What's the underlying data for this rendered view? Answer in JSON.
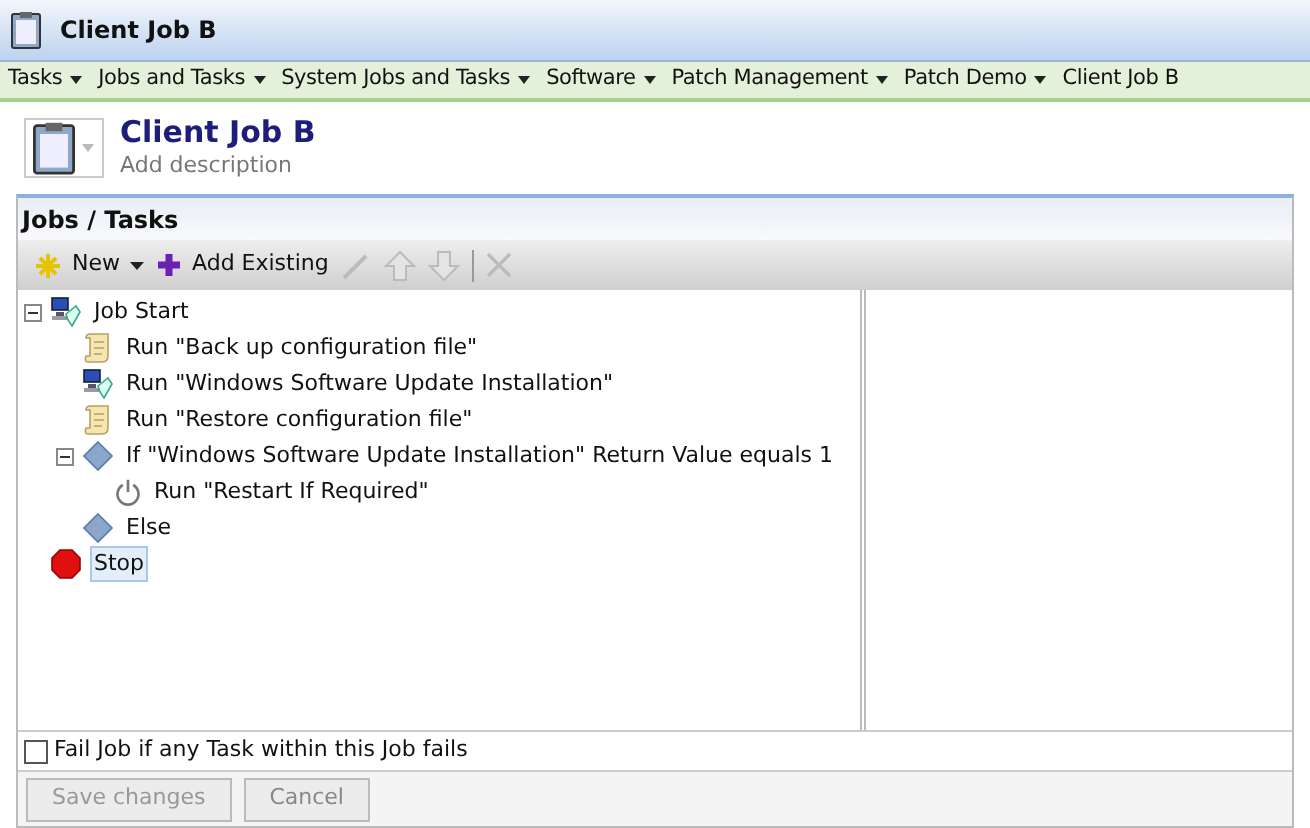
{
  "window": {
    "title": "Client Job B"
  },
  "menu": [
    {
      "label": "Tasks",
      "dropdown": true
    },
    {
      "label": "Jobs and Tasks",
      "dropdown": true
    },
    {
      "label": "System Jobs and Tasks",
      "dropdown": true
    },
    {
      "label": "Software",
      "dropdown": true
    },
    {
      "label": "Patch Management",
      "dropdown": true
    },
    {
      "label": "Patch Demo",
      "dropdown": true
    },
    {
      "label": "Client Job B",
      "dropdown": false
    }
  ],
  "header": {
    "title": "Client Job B",
    "description": "Add description"
  },
  "panel": {
    "title": "Jobs / Tasks",
    "toolbar": [
      {
        "kind": "new",
        "label": "New",
        "disabled": false
      },
      {
        "kind": "add",
        "label": "Add Existing",
        "disabled": false
      },
      {
        "kind": "edit",
        "disabled": true
      },
      {
        "kind": "up",
        "disabled": true
      },
      {
        "kind": "down",
        "disabled": true
      },
      {
        "kind": "sep"
      },
      {
        "kind": "delete",
        "disabled": true
      }
    ],
    "tree": [
      {
        "label": "Job Start",
        "kind": "job",
        "expanded": true,
        "selected": false,
        "children": [
          {
            "label": "Run \"Back up configuration file\"",
            "kind": "script",
            "selected": false
          },
          {
            "label": "Run \"Windows Software Update Installation\"",
            "kind": "job",
            "selected": false
          },
          {
            "label": "Run \"Restore configuration file\"",
            "kind": "script",
            "selected": false
          },
          {
            "label": "If \"Windows Software Update Installation\" Return Value equals 1",
            "kind": "condition",
            "expanded": true,
            "selected": false,
            "children": [
              {
                "label": "Run \"Restart If Required\"",
                "kind": "power",
                "selected": false
              }
            ]
          },
          {
            "label": "Else",
            "kind": "condition",
            "selected": false
          }
        ]
      },
      {
        "label": "Stop",
        "kind": "stop",
        "selected": true
      }
    ]
  },
  "fail_option": {
    "label": "Fail Job if any Task within this Job fails",
    "checked": false
  },
  "buttons": [
    {
      "label": "Save changes",
      "disabled": true
    },
    {
      "label": "Cancel",
      "disabled": false
    }
  ]
}
